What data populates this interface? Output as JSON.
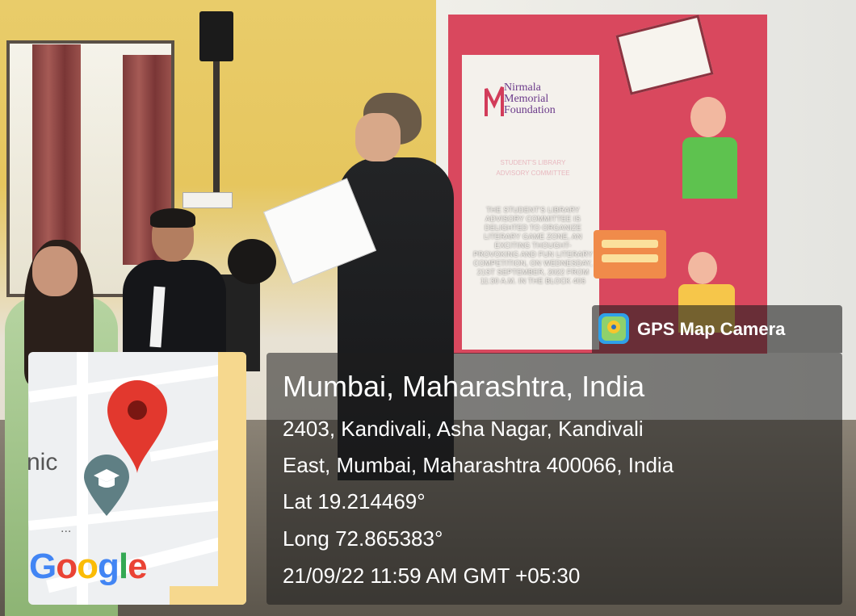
{
  "poster": {
    "logo_line1": "Nirmala",
    "logo_line2": "Memorial",
    "logo_line3": "Foundation",
    "faded_heading": "STUDENT'S LIBRARY ADVISORY COMMITTEE",
    "body_text": "THE STUDENT'S LIBRARY ADVISORY COMMITTEE IS DELIGHTED TO ORGANIZE LITERARY GAME ZONE, AN EXCITING THOUGHT-PROVOKING AND FUN LITERARY COMPETITION, ON WEDNESDAY, 21ST SEPTEMBER, 2022 FROM 11:30 A.M. IN THE BLOCK 406"
  },
  "overlay": {
    "brand": "GPS Map Camera",
    "location_title": "Mumbai, Maharashtra, India",
    "address_line1": "2403, Kandivali, Asha Nagar, Kandivali",
    "address_line2": "East, Mumbai, Maharashtra 400066, India",
    "latitude": "Lat 19.214469°",
    "longitude": "Long 72.865383°",
    "timestamp": "21/09/22 11:59 AM GMT +05:30"
  },
  "map": {
    "label_fragment": "nic",
    "dots": "...",
    "attribution": "Google",
    "icons": [
      "location-pin-icon",
      "graduation-cap-icon"
    ]
  },
  "colors": {
    "poster_red": "#d9485e",
    "pin_red": "#e2382e",
    "google_blue": "#4285f4",
    "google_red": "#ea4335",
    "google_yellow": "#fbbc05",
    "google_green": "#34a853"
  }
}
